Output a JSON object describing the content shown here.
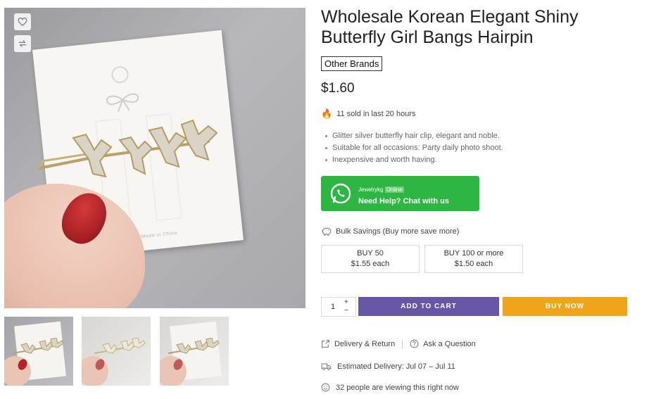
{
  "product": {
    "title": "Wholesale Korean Elegant Shiny Butterfly Girl Bangs Hairpin",
    "brand": "Other Brands",
    "price": "$1.60",
    "sold_text": "11 sold in last 20 hours",
    "bullets": [
      "Glitter silver butterfly hair clip, elegant and noble.",
      "Suitable for all occasions: Party daily photo shoot.",
      "Inexpensive and worth having."
    ],
    "card_text": "Made in China"
  },
  "gallery": {
    "wishlist_icon": "heart-icon",
    "compare_icon": "compare-icon",
    "thumbnails": [
      "thumb-1",
      "thumb-2",
      "thumb-3"
    ]
  },
  "whatsapp": {
    "name": "Jewelrykg",
    "status": "Online",
    "cta": "Need Help? Chat with us",
    "color": "#2db742"
  },
  "bulk": {
    "label": "Bulk Savings (Buy more save more)",
    "tiers": [
      {
        "qty_label": "BUY 50",
        "price_label": "$1.55 each"
      },
      {
        "qty_label": "BUY 100 or more",
        "price_label": "$1.50 each"
      }
    ]
  },
  "cart": {
    "quantity": "1",
    "plus": "+",
    "minus": "−",
    "add_to_cart": "ADD TO CART",
    "buy_now": "BUY NOW",
    "add_color": "#6756a6",
    "buy_color": "#f0a41a"
  },
  "info": {
    "delivery_return": "Delivery & Return",
    "ask_question": "Ask a Question",
    "estimated_delivery": "Estimated Delivery: Jul 07 – Jul 11",
    "viewing": "32 people are viewing this right now"
  }
}
